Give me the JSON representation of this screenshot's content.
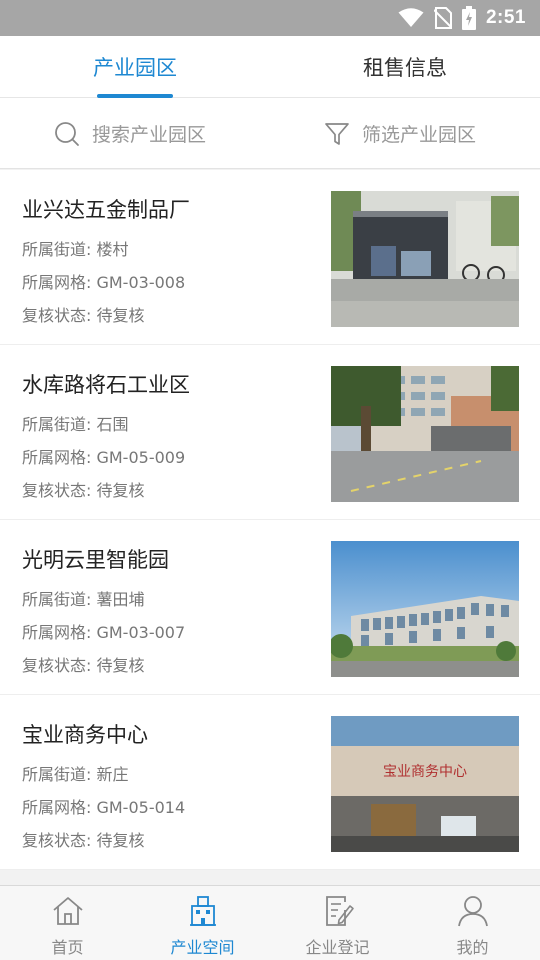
{
  "status_bar": {
    "time": "2:51",
    "icons": [
      "wifi-icon",
      "no-sim-icon",
      "battery-icon"
    ]
  },
  "top_tabs": [
    {
      "label": "产业园区",
      "active": true
    },
    {
      "label": "租售信息",
      "active": false
    }
  ],
  "search": {
    "search_label": "搜索产业园区",
    "filter_label": "筛选产业园区"
  },
  "colors": {
    "accent": "#1e88d2",
    "status_bar": "#a6a6a6"
  },
  "items": [
    {
      "title": "业兴达五金制品厂",
      "street": "所属街道: 楼村",
      "grid": "所属网格: GM-03-008",
      "status": "复核状态: 待复核"
    },
    {
      "title": "水库路将石工业区",
      "street": "所属街道: 石围",
      "grid": "所属网格: GM-05-009",
      "status": "复核状态: 待复核"
    },
    {
      "title": "光明云里智能园",
      "street": "所属街道: 薯田埔",
      "grid": "所属网格: GM-03-007",
      "status": "复核状态: 待复核"
    },
    {
      "title": "宝业商务中心",
      "street": "所属街道: 新庄",
      "grid": "所属网格: GM-05-014",
      "status": "复核状态: 待复核",
      "sign_text": "宝业商务中心"
    }
  ],
  "bottom_nav": [
    {
      "label": "首页",
      "icon": "home-icon",
      "active": false
    },
    {
      "label": "产业空间",
      "icon": "building-icon",
      "active": true
    },
    {
      "label": "企业登记",
      "icon": "register-icon",
      "active": false
    },
    {
      "label": "我的",
      "icon": "user-icon",
      "active": false
    }
  ]
}
